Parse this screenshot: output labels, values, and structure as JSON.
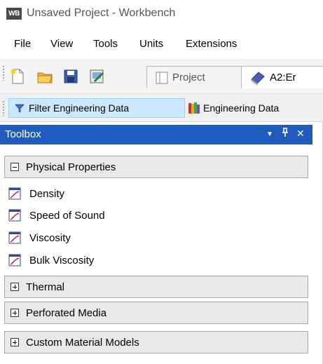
{
  "window": {
    "logo_text": "WB",
    "title": "Unsaved Project - Workbench"
  },
  "menu": {
    "items": [
      "File",
      "View",
      "Tools",
      "Units",
      "Extensions"
    ]
  },
  "toolbar": {
    "tabs": [
      {
        "label": "Project",
        "icon": "project-schematic-icon"
      },
      {
        "label": "A2:Er",
        "icon": "engineering-data-book-icon"
      }
    ]
  },
  "filterbar": {
    "filter_label": "Filter Engineering Data",
    "engineering_data_label": "Engineering Data"
  },
  "toolbox": {
    "title": "Toolbox",
    "groups": [
      {
        "label": "Physical Properties",
        "expanded": true,
        "items": [
          "Density",
          "Speed of Sound",
          "Viscosity",
          "Bulk Viscosity"
        ]
      },
      {
        "label": "Thermal",
        "expanded": false
      },
      {
        "label": "Perforated Media",
        "expanded": false
      },
      {
        "label": "Custom Material Models",
        "expanded": false
      }
    ]
  },
  "colors": {
    "panel_header": "#1f5cbd",
    "filter_highlight": "#cce8ff"
  }
}
